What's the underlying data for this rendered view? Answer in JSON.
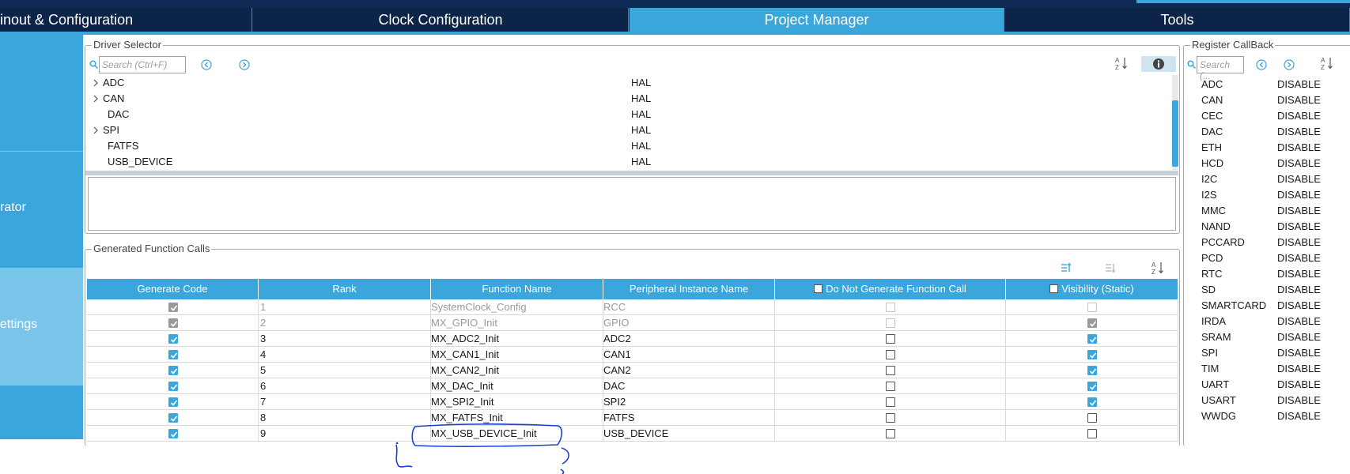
{
  "top_tabs": [
    {
      "label": "inout & Configuration"
    },
    {
      "label": "Clock Configuration"
    },
    {
      "label": "Project Manager"
    },
    {
      "label": "Tools"
    }
  ],
  "sidebar": {
    "items": [
      {
        "label": ""
      },
      {
        "label": "rator"
      },
      {
        "label": "ettings"
      },
      {
        "label": ""
      }
    ]
  },
  "driver_selector": {
    "title": "Driver Selector",
    "search_placeholder": "Search (Ctrl+F)",
    "rows": [
      {
        "name": "ADC",
        "value": "HAL",
        "expandable": true
      },
      {
        "name": "CAN",
        "value": "HAL",
        "expandable": true
      },
      {
        "name": "DAC",
        "value": "HAL",
        "expandable": false
      },
      {
        "name": "SPI",
        "value": "HAL",
        "expandable": true
      },
      {
        "name": "FATFS",
        "value": "HAL",
        "expandable": false
      },
      {
        "name": "USB_DEVICE",
        "value": "HAL",
        "expandable": false
      }
    ]
  },
  "generated_function_calls": {
    "title": "Generated Function Calls",
    "columns": [
      "Generate Code",
      "Rank",
      "Function Name",
      "Peripheral Instance Name",
      "Do Not Generate Function Call",
      "Visibility (Static)"
    ],
    "rows": [
      {
        "generate": true,
        "rank": "1",
        "function": "SystemClock_Config",
        "peripheral": "RCC",
        "do_not_generate": false,
        "visibility": false,
        "disabled": true
      },
      {
        "generate": true,
        "rank": "2",
        "function": "MX_GPIO_Init",
        "peripheral": "GPIO",
        "do_not_generate": false,
        "visibility": true,
        "disabled": true
      },
      {
        "generate": true,
        "rank": "3",
        "function": "MX_ADC2_Init",
        "peripheral": "ADC2",
        "do_not_generate": false,
        "visibility": true,
        "disabled": false
      },
      {
        "generate": true,
        "rank": "4",
        "function": "MX_CAN1_Init",
        "peripheral": "CAN1",
        "do_not_generate": false,
        "visibility": true,
        "disabled": false
      },
      {
        "generate": true,
        "rank": "5",
        "function": "MX_CAN2_Init",
        "peripheral": "CAN2",
        "do_not_generate": false,
        "visibility": true,
        "disabled": false
      },
      {
        "generate": true,
        "rank": "6",
        "function": "MX_DAC_Init",
        "peripheral": "DAC",
        "do_not_generate": false,
        "visibility": true,
        "disabled": false
      },
      {
        "generate": true,
        "rank": "7",
        "function": "MX_SPI2_Init",
        "peripheral": "SPI2",
        "do_not_generate": false,
        "visibility": true,
        "disabled": false
      },
      {
        "generate": true,
        "rank": "8",
        "function": "MX_FATFS_Init",
        "peripheral": "FATFS",
        "do_not_generate": false,
        "visibility": false,
        "disabled": false
      },
      {
        "generate": true,
        "rank": "9",
        "function": "MX_USB_DEVICE_Init",
        "peripheral": "USB_DEVICE",
        "do_not_generate": false,
        "visibility": false,
        "disabled": false
      }
    ]
  },
  "register_callback": {
    "title": "Register CallBack",
    "search_placeholder": "Search (...",
    "rows": [
      {
        "name": "ADC",
        "value": "DISABLE"
      },
      {
        "name": "CAN",
        "value": "DISABLE"
      },
      {
        "name": "CEC",
        "value": "DISABLE"
      },
      {
        "name": "DAC",
        "value": "DISABLE"
      },
      {
        "name": "ETH",
        "value": "DISABLE"
      },
      {
        "name": "HCD",
        "value": "DISABLE"
      },
      {
        "name": "I2C",
        "value": "DISABLE"
      },
      {
        "name": "I2S",
        "value": "DISABLE"
      },
      {
        "name": "MMC",
        "value": "DISABLE"
      },
      {
        "name": "NAND",
        "value": "DISABLE"
      },
      {
        "name": "PCCARD",
        "value": "DISABLE"
      },
      {
        "name": "PCD",
        "value": "DISABLE"
      },
      {
        "name": "RTC",
        "value": "DISABLE"
      },
      {
        "name": "SD",
        "value": "DISABLE"
      },
      {
        "name": "SMARTCARD",
        "value": "DISABLE"
      },
      {
        "name": "IRDA",
        "value": "DISABLE"
      },
      {
        "name": "SRAM",
        "value": "DISABLE"
      },
      {
        "name": "SPI",
        "value": "DISABLE"
      },
      {
        "name": "TIM",
        "value": "DISABLE"
      },
      {
        "name": "UART",
        "value": "DISABLE"
      },
      {
        "name": "USART",
        "value": "DISABLE"
      },
      {
        "name": "WWDG",
        "value": "DISABLE"
      }
    ]
  },
  "colors": {
    "accent": "#3aa6dc",
    "navy": "#0b2447",
    "annotation": "#1a3fd1"
  }
}
